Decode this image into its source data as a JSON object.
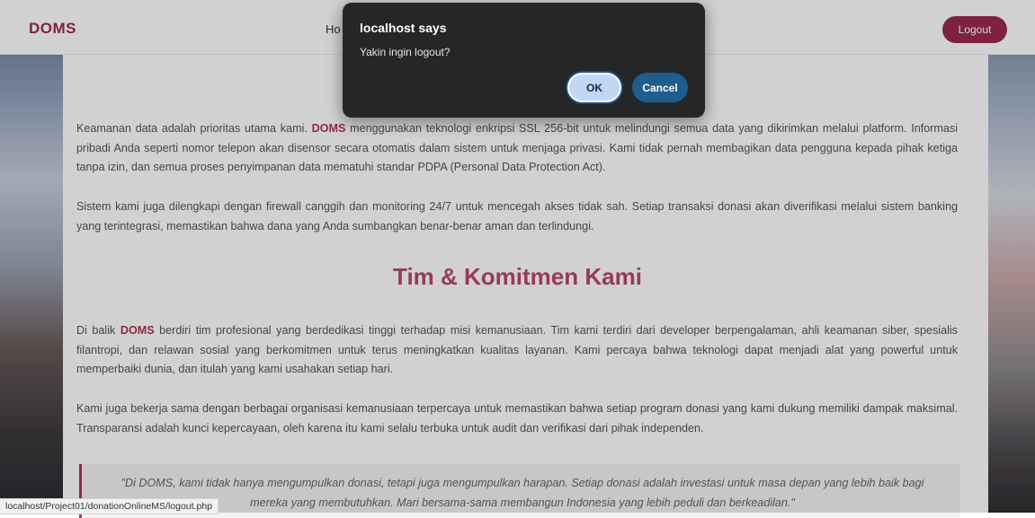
{
  "header": {
    "brand": "DOMS",
    "nav_home": "Ho",
    "logout_label": "Logout"
  },
  "content": {
    "p1a": "Keamanan data adalah prioritas utama kami. ",
    "p1brand": "DOMS",
    "p1b": " menggunakan teknologi enkripsi SSL 256-bit untuk melindungi semua data yang dikirimkan melalui platform. Informasi pribadi Anda seperti nomor telepon akan disensor secara otomatis dalam sistem untuk menjaga privasi. Kami tidak pernah membagikan data pengguna kepada pihak ketiga tanpa izin, dan semua proses penyimpanan data mematuhi standar PDPA (Personal Data Protection Act).",
    "p2": "Sistem kami juga dilengkapi dengan firewall canggih dan monitoring 24/7 untuk mencegah akses tidak sah. Setiap transaksi donasi akan diverifikasi melalui sistem banking yang terintegrasi, memastikan bahwa dana yang Anda sumbangkan benar-benar aman dan terlindungi.",
    "section_title": "Tim & Komitmen Kami",
    "p3a": "Di balik ",
    "p3brand": "DOMS",
    "p3b": " berdiri tim profesional yang berdedikasi tinggi terhadap misi kemanusiaan. Tim kami terdiri dari developer berpengalaman, ahli keamanan siber, spesialis filantropi, dan relawan sosial yang berkomitmen untuk terus meningkatkan kualitas layanan. Kami percaya bahwa teknologi dapat menjadi alat yang powerful untuk memperbaiki dunia, dan itulah yang kami usahakan setiap hari.",
    "p4": "Kami juga bekerja sama dengan berbagai organisasi kemanusiaan terpercaya untuk memastikan bahwa setiap program donasi yang kami dukung memiliki dampak maksimal. Transparansi adalah kunci kepercayaan, oleh karena itu kami selalu terbuka untuk audit dan verifikasi dari pihak independen.",
    "quote": "\"Di DOMS, kami tidak hanya mengumpulkan donasi, tetapi juga mengumpulkan harapan. Setiap donasi adalah investasi untuk masa depan yang lebih baik bagi mereka yang membutuhkan. Mari bersama-sama membangun Indonesia yang lebih peduli dan berkeadilan.\""
  },
  "status_url": "localhost/Project01/donationOnlineMS/logout.php",
  "dialog": {
    "title": "localhost says",
    "message": "Yakin ingin logout?",
    "ok_label": "OK",
    "cancel_label": "Cancel"
  },
  "colors": {
    "brand": "#9b2a4d",
    "dialog_bg": "#252628",
    "cancel_btn": "#1f5d8f",
    "ok_btn": "#c3d7f5"
  }
}
